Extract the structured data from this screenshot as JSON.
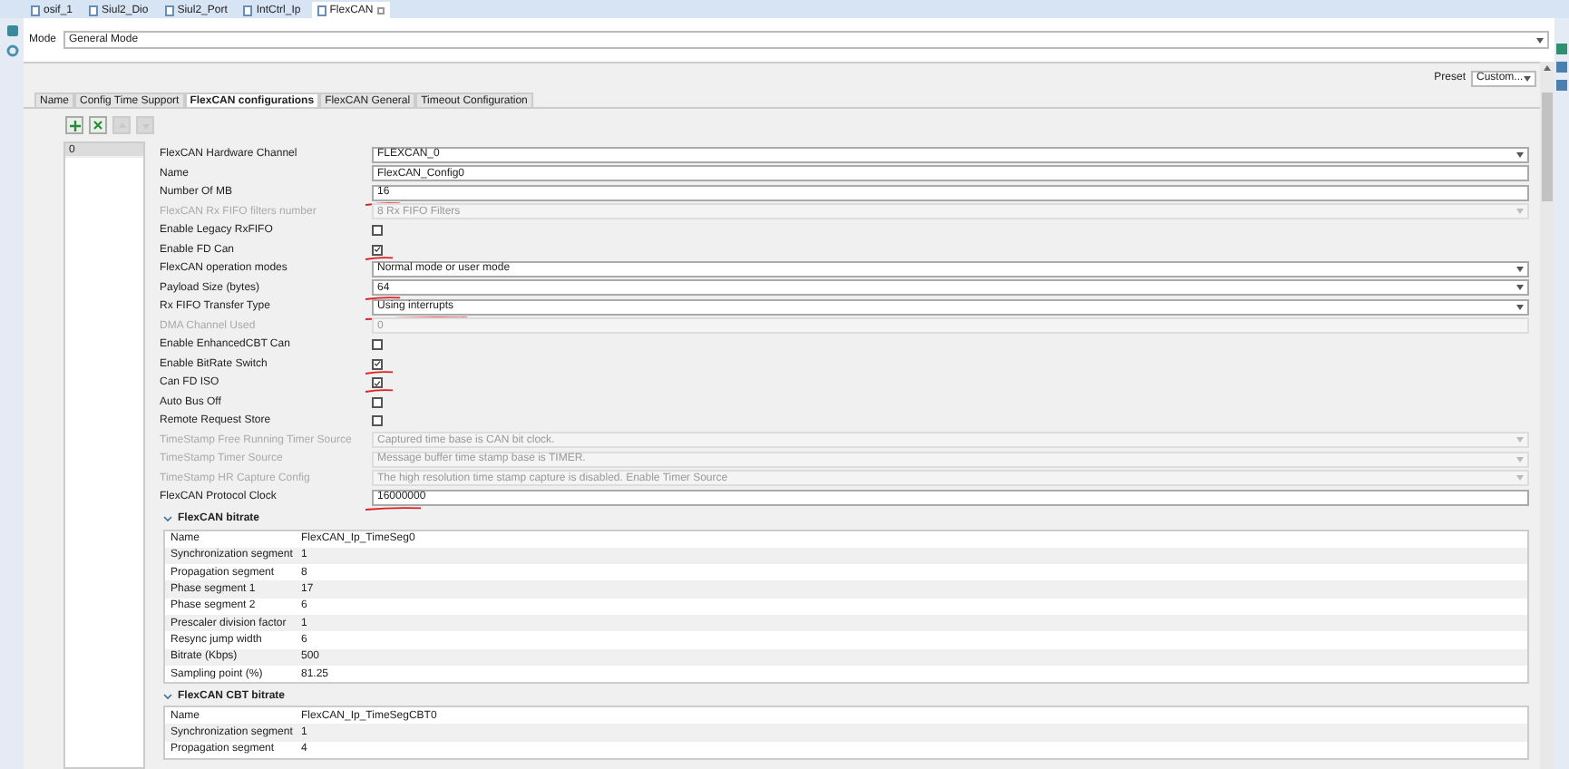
{
  "editor_tabs": [
    {
      "label": "osif_1",
      "selected": false
    },
    {
      "label": "Siul2_Dio",
      "selected": false
    },
    {
      "label": "Siul2_Port",
      "selected": false
    },
    {
      "label": "IntCtrl_Ip",
      "selected": false
    },
    {
      "label": "FlexCAN",
      "selected": true,
      "closable": true
    }
  ],
  "mode": {
    "label": "Mode",
    "value": "General Mode"
  },
  "preset": {
    "label": "Preset",
    "value": "Custom..."
  },
  "config_tabs": [
    {
      "label": "Name",
      "selected": false
    },
    {
      "label": "Config Time Support",
      "selected": false
    },
    {
      "label": "FlexCAN configurations",
      "selected": true
    },
    {
      "label": "FlexCAN General",
      "selected": false
    },
    {
      "label": "Timeout Configuration",
      "selected": false
    }
  ],
  "toolbar": [
    {
      "kind": "add",
      "disabled": false
    },
    {
      "kind": "remove",
      "disabled": false
    },
    {
      "kind": "up",
      "disabled": true
    },
    {
      "kind": "down",
      "disabled": true
    }
  ],
  "config_list": [
    {
      "label": "0",
      "selected": true
    }
  ],
  "fields": [
    {
      "label": "FlexCAN Hardware Channel",
      "kind": "select",
      "value": "FLEXCAN_0",
      "disabled": false,
      "marked": false
    },
    {
      "label": "Name",
      "kind": "text",
      "value": "FlexCAN_Config0",
      "disabled": false,
      "marked": false
    },
    {
      "label": "Number Of MB",
      "kind": "text",
      "value": "16",
      "disabled": false,
      "marked": true
    },
    {
      "label": "FlexCAN Rx FIFO filters number",
      "kind": "select",
      "value": "8 Rx FIFO Filters",
      "disabled": true,
      "marked": false
    },
    {
      "label": "Enable Legacy RxFIFO",
      "kind": "checkbox",
      "checked": false,
      "disabled": false,
      "marked": false
    },
    {
      "label": "Enable FD Can",
      "kind": "checkbox",
      "checked": true,
      "disabled": false,
      "marked": true
    },
    {
      "label": "FlexCAN operation modes",
      "kind": "select",
      "value": "Normal mode or user mode",
      "disabled": false,
      "marked": false
    },
    {
      "label": "Payload Size (bytes)",
      "kind": "select",
      "value": "64",
      "disabled": false,
      "marked": true
    },
    {
      "label": "Rx FIFO Transfer Type",
      "kind": "select",
      "value": "Using interrupts",
      "disabled": false,
      "marked": true
    },
    {
      "label": "DMA Channel Used",
      "kind": "text",
      "value": "0",
      "disabled": true,
      "marked": false
    },
    {
      "label": "Enable EnhancedCBT Can",
      "kind": "checkbox",
      "checked": false,
      "disabled": false,
      "marked": false
    },
    {
      "label": "Enable BitRate Switch",
      "kind": "checkbox",
      "checked": true,
      "disabled": false,
      "marked": true
    },
    {
      "label": "Can FD ISO",
      "kind": "checkbox",
      "checked": true,
      "disabled": false,
      "marked": true
    },
    {
      "label": "Auto Bus Off",
      "kind": "checkbox",
      "checked": false,
      "disabled": false,
      "marked": false
    },
    {
      "label": "Remote Request Store",
      "kind": "checkbox",
      "checked": false,
      "disabled": false,
      "marked": false
    },
    {
      "label": "TimeStamp Free Running Timer Source",
      "kind": "select",
      "value": "Captured time base is CAN bit clock.",
      "disabled": true,
      "marked": false
    },
    {
      "label": "TimeStamp Timer Source",
      "kind": "select",
      "value": "Message buffer time stamp base is TIMER.",
      "disabled": true,
      "marked": false
    },
    {
      "label": "TimeStamp HR Capture Config",
      "kind": "select",
      "value": "The high resolution time stamp capture is disabled. Enable Timer Source",
      "disabled": true,
      "marked": false
    },
    {
      "label": "FlexCAN Protocol Clock",
      "kind": "text",
      "value": "16000000",
      "disabled": false,
      "marked": true
    }
  ],
  "groups": [
    {
      "title": "FlexCAN bitrate",
      "expanded": true,
      "rows": [
        {
          "name": "Name",
          "value": "FlexCAN_Ip_TimeSeg0"
        },
        {
          "name": "Synchronization segment",
          "value": "1"
        },
        {
          "name": "Propagation segment",
          "value": "8"
        },
        {
          "name": "Phase segment 1",
          "value": "17"
        },
        {
          "name": "Phase segment 2",
          "value": "6"
        },
        {
          "name": "Prescaler division factor",
          "value": "1"
        },
        {
          "name": "Resync jump width",
          "value": "6"
        },
        {
          "name": "Bitrate (Kbps)",
          "value": "500"
        },
        {
          "name": "Sampling point (%)",
          "value": "81.25"
        }
      ]
    },
    {
      "title": "FlexCAN CBT bitrate",
      "expanded": true,
      "rows": [
        {
          "name": "Name",
          "value": "FlexCAN_Ip_TimeSegCBT0"
        },
        {
          "name": "Synchronization segment",
          "value": "1"
        },
        {
          "name": "Propagation segment",
          "value": "4"
        }
      ]
    }
  ]
}
